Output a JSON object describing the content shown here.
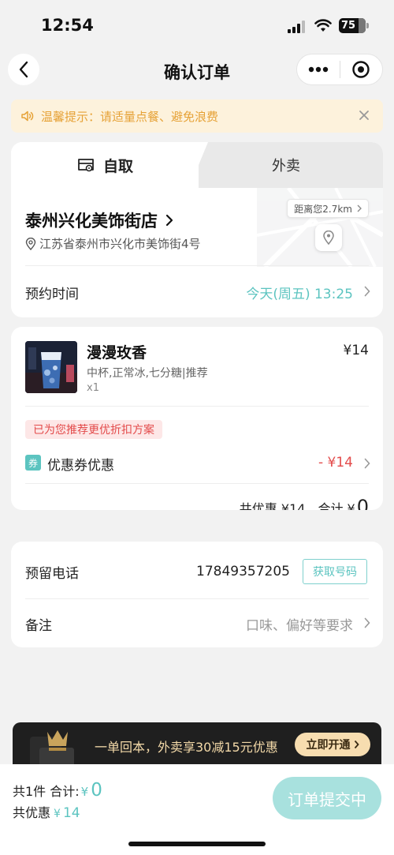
{
  "status_bar": {
    "time": "12:54",
    "battery": "75"
  },
  "nav": {
    "title": "确认订单"
  },
  "notice": {
    "text": "温馨提示：请适量点餐、避免浪费"
  },
  "tabs": {
    "pickup": "自取",
    "delivery": "外卖"
  },
  "store": {
    "name": "泰州兴化美饰街店",
    "address": "江苏省泰州市兴化市美饰街4号",
    "distance": "距离您2.7km",
    "reserve_label": "预约时间",
    "reserve_value": "今天(周五) 13:25"
  },
  "product": {
    "name": "漫漫玫香",
    "spec": "中杯,正常冰,七分糖|推荐",
    "qty": "x1",
    "price": "¥14",
    "promo_tag": "已为您推荐更优折扣方案",
    "coupon_badge": "券",
    "coupon_label": "优惠券优惠",
    "coupon_value": "- ¥14",
    "summary_discount": "共优惠 ¥14",
    "summary_total_label": "合计 ¥",
    "summary_total_value": "0"
  },
  "contact": {
    "phone_label": "预留电话",
    "phone_value": "17849357205",
    "get_number": "获取号码",
    "remark_label": "备注",
    "remark_placeholder": "口味、偏好等要求"
  },
  "banner": {
    "text": "一单回本，外卖享30减15元优惠",
    "button": "立即开通"
  },
  "bottom": {
    "count_label": "共1件 合计:",
    "currency": "¥",
    "total": "0",
    "discount_label": "共优惠",
    "discount_value": "14",
    "submit": "订单提交中"
  },
  "colors": {
    "accent": "#5cc4c0",
    "warning": "#e6a237",
    "discount_red": "#e34b4b",
    "banner_gold": "#f3d9a8"
  },
  "icons": {
    "back": "chevron-left-icon",
    "more": "more-dots-icon",
    "close_mini": "target-circle-icon",
    "notice": "speaker-icon",
    "notice_close": "close-icon",
    "pickup": "store-icon",
    "address": "location-pin-icon"
  }
}
